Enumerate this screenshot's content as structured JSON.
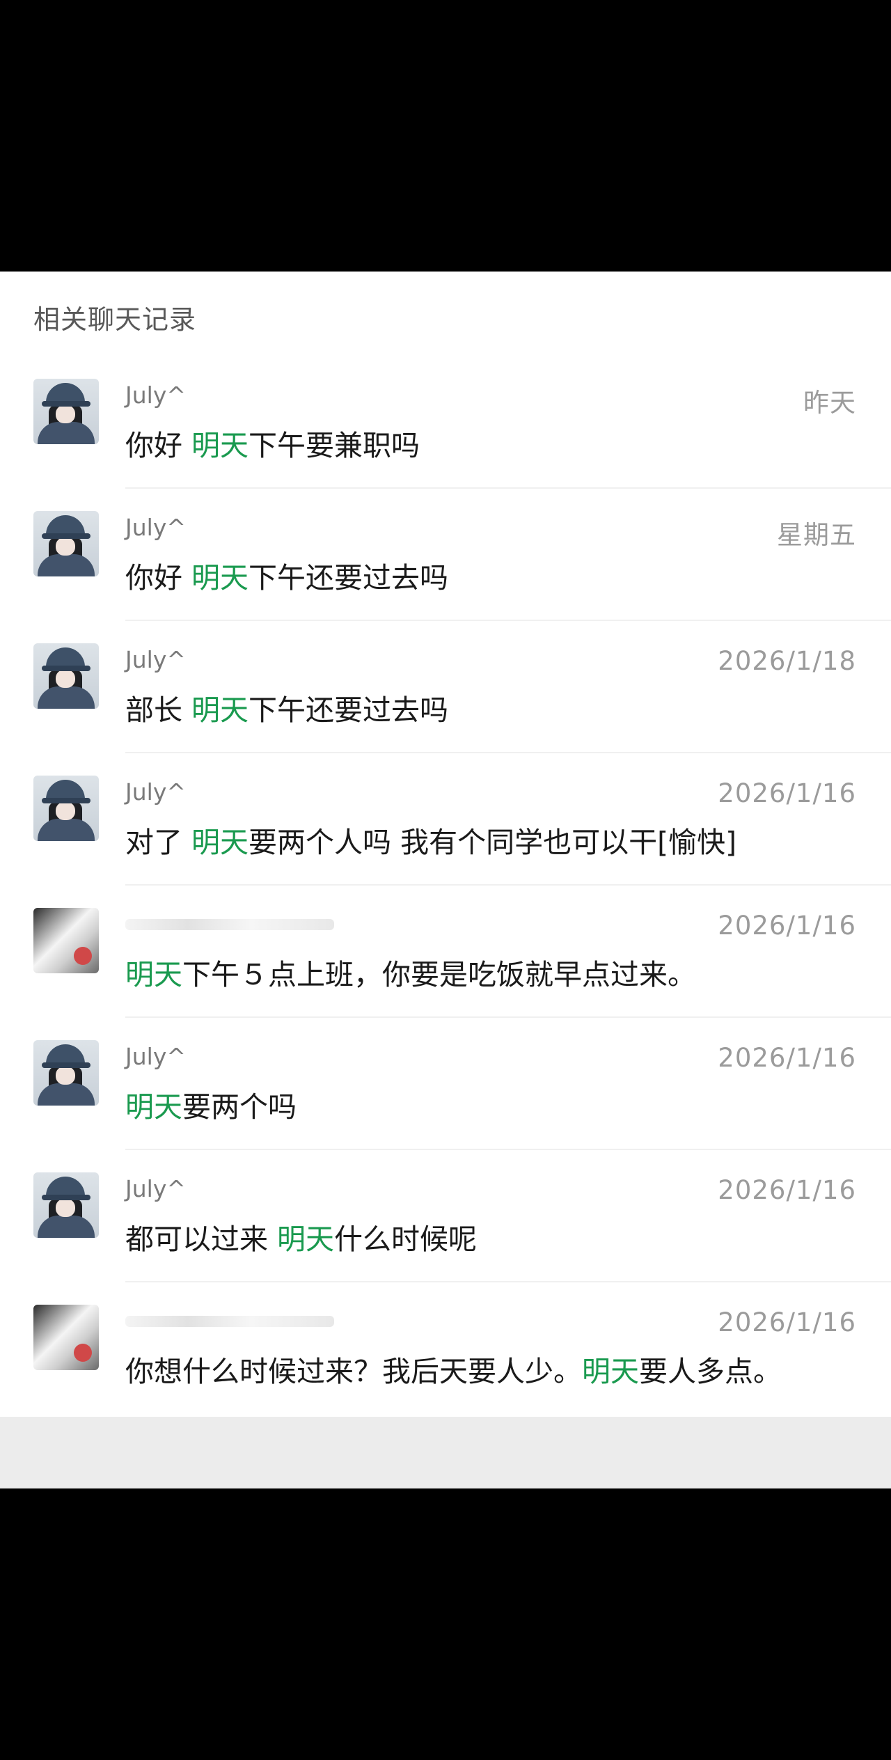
{
  "section_title": "相关聊天记录",
  "colors": {
    "highlight": "#1a9a4f",
    "text": "#1a1a1a",
    "meta": "#9b9b9b"
  },
  "results": [
    {
      "sender": "July^",
      "date": "昨天",
      "before": "你好 ",
      "keyword": "明天",
      "after": "下午要兼职吗"
    },
    {
      "sender": "July^",
      "date": "星期五",
      "before": "你好 ",
      "keyword": "明天",
      "after": "下午还要过去吗"
    },
    {
      "sender": "July^",
      "date": "2026/1/18",
      "before": "部长 ",
      "keyword": "明天",
      "after": "下午还要过去吗"
    },
    {
      "sender": "July^",
      "date": "2026/1/16",
      "before": "对了 ",
      "keyword": "明天",
      "after": "要两个人吗 我有个同学也可以干[愉快]"
    },
    {
      "sender": "",
      "date": "2026/1/16",
      "before": "",
      "keyword": "明天",
      "after": "下午５点上班，你要是吃饭就早点过来。"
    },
    {
      "sender": "July^",
      "date": "2026/1/16",
      "before": "",
      "keyword": "明天",
      "after": "要两个吗"
    },
    {
      "sender": "July^",
      "date": "2026/1/16",
      "before": "都可以过来 ",
      "keyword": "明天",
      "after": "什么时候呢"
    },
    {
      "sender": "",
      "date": "2026/1/16",
      "before": "你想什么时候过来？我后天要人少。",
      "keyword": "明天",
      "after": "要人多点。"
    }
  ]
}
